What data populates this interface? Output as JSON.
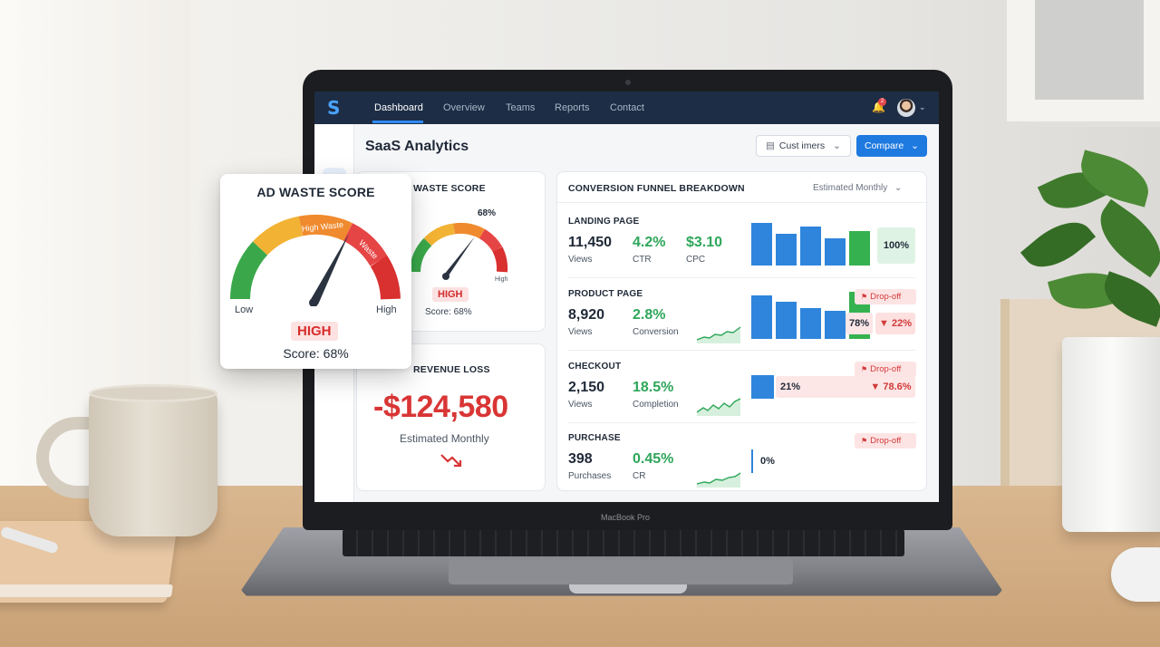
{
  "nav": {
    "logo": "S",
    "items": [
      {
        "label": "Dashboard",
        "active": true
      },
      {
        "label": "Overview"
      },
      {
        "label": "Teams"
      },
      {
        "label": "Reports"
      },
      {
        "label": "Contact"
      }
    ],
    "notification_count": "2"
  },
  "header": {
    "title": "SaaS Analytics",
    "customers_label": "Cust imers",
    "compare_label": "Compare"
  },
  "ad_waste": {
    "title": "WASTE SCORE",
    "popup_title": "AD WASTE SCORE",
    "percent_label": "68%",
    "level": "HIGH",
    "score_text": "Score: 68%",
    "score_value": 68,
    "low_label": "Low",
    "high_label": "High",
    "zone_labels": [
      "High Waste",
      "Waste"
    ],
    "gauge_colors": [
      "#3aa84a",
      "#f2b233",
      "#f08a2e",
      "#e64545",
      "#d93030"
    ]
  },
  "revenue_loss": {
    "title": "REVENUE LOSS",
    "value": "-$124,580",
    "subtitle": "Estimated Monthly"
  },
  "funnel": {
    "title": "CONVERSION FUNNEL BREAKDOWN",
    "period": "Estimated Monthly",
    "stages": [
      {
        "name": "LANDING PAGE",
        "metrics": [
          {
            "value": "11,450",
            "label": "Views"
          },
          {
            "value": "4.2%",
            "label": "CTR"
          },
          {
            "value": "$3.10",
            "label": "CPC"
          }
        ],
        "retention": "100%"
      },
      {
        "name": "PRODUCT PAGE",
        "metrics": [
          {
            "value": "8,920",
            "label": "Views"
          },
          {
            "value": "2.8%",
            "label": "Conversion"
          }
        ],
        "badge": "Drop-off",
        "retention": "78%",
        "dropoff": "▼ 22%"
      },
      {
        "name": "CHECKOUT",
        "metrics": [
          {
            "value": "2,150",
            "label": "Views"
          },
          {
            "value": "18.5%",
            "label": "Completion"
          }
        ],
        "badge": "Drop-off",
        "retention": "21%",
        "dropoff": "▼ 78.6%"
      },
      {
        "name": "PURCHASE",
        "metrics": [
          {
            "value": "398",
            "label": "Purchases"
          },
          {
            "value": "0.45%",
            "label": "CR"
          }
        ],
        "badge": "Drop-off",
        "retention": "0%"
      }
    ]
  },
  "laptop": {
    "brand": "MacBook Pro"
  },
  "colors": {
    "nav_bg": "#1d2d45",
    "accent_blue": "#1f7ae0",
    "bar_blue": "#2f85dc",
    "bar_green": "#35b24f",
    "loss_red": "#d93535",
    "positive_green": "#2ea65a"
  }
}
